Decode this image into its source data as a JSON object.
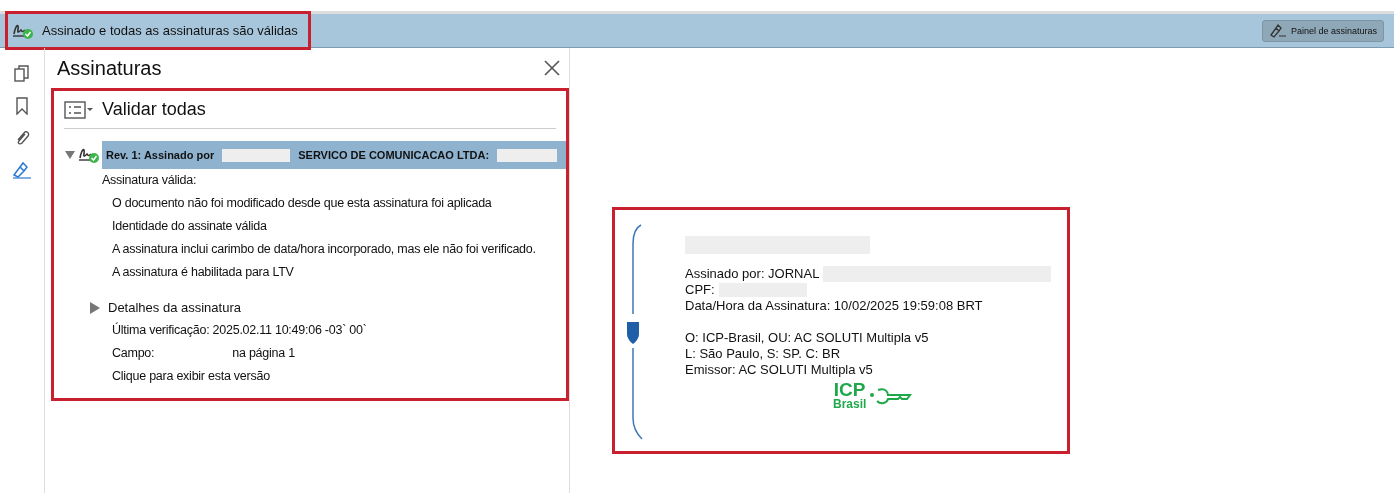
{
  "status_bar": {
    "text": "Assinado e todas as assinaturas são válidas",
    "button": "Painel de assinaturas"
  },
  "sidebar": {
    "items": [
      {
        "kind": "pages",
        "selected": false
      },
      {
        "kind": "bookmark",
        "selected": false
      },
      {
        "kind": "attachment",
        "selected": false
      },
      {
        "kind": "signature",
        "selected": true
      }
    ]
  },
  "panel": {
    "title": "Assinaturas",
    "validate_all": "Validar todas",
    "signature": {
      "expanded": true,
      "selected": true,
      "title_start": "Rev. 1: Assinado por",
      "title_middle": "SERVICO DE COMUNICACAO LTDA:",
      "status": "Assinatura válida:",
      "checks": [
        "O documento não foi modificado desde que esta assinatura foi aplicada",
        "Identidade do assinate válida",
        "A assinatura inclui carimbo de data/hora incorporado, mas ele não foi verificado.",
        "A assinatura é habilitada para LTV"
      ],
      "details": {
        "label": "Detalhes da assinatura",
        "expanded": false
      },
      "last_check": "Última verificação: 2025.02.11   10:49:06 -03` 00`",
      "field_label": "Campo:",
      "field_page": "na página 1",
      "view_version": "Clique para exibir esta versão"
    }
  },
  "signature_card": {
    "signed_by": "Assinado por: JORNAL",
    "cpf": "CPF:",
    "date": "Data/Hora da Assinatura: 10/02/2025 19:59:08 BRT",
    "lines": [
      "O: ICP-Brasil, OU: AC SOLUTI Multipla v5",
      "L: São Paulo, S: SP. C: BR",
      "Emissor: AC SOLUTI Multipla v5"
    ],
    "logo_top": "ICP",
    "logo_bottom": "Brasil"
  }
}
